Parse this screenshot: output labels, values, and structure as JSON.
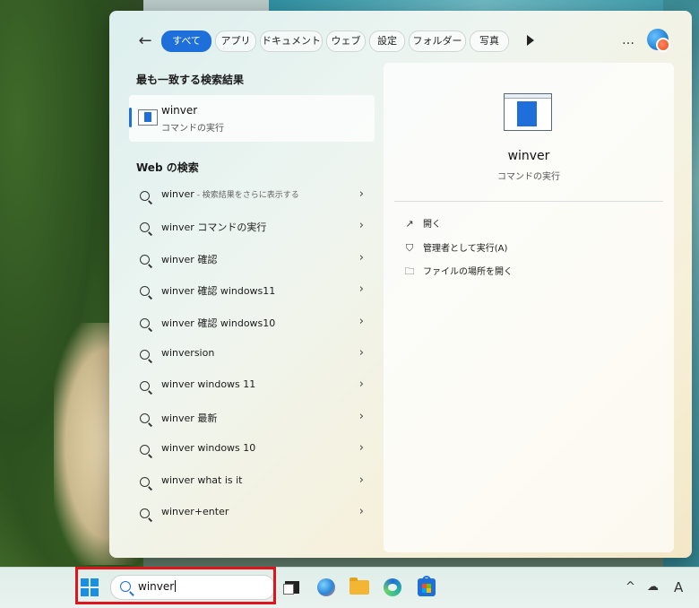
{
  "filters": {
    "back_icon": "arrow-left-icon",
    "chips": [
      {
        "label": "すべて",
        "active": true
      },
      {
        "label": "アプリ"
      },
      {
        "label": "ドキュメント"
      },
      {
        "label": "ウェブ"
      },
      {
        "label": "設定"
      },
      {
        "label": "フォルダー"
      },
      {
        "label": "写真"
      }
    ],
    "more": "…"
  },
  "best_match": {
    "section_title": "最も一致する検索結果",
    "name": "winver",
    "sub": "コマンドの実行"
  },
  "web": {
    "section_title": "Web の検索",
    "items": [
      {
        "label": "winver",
        "hint": " - 検索結果をさらに表示する"
      },
      {
        "label": "winver コマンドの実行"
      },
      {
        "label": "winver 確認"
      },
      {
        "label": "winver 確認 windows11"
      },
      {
        "label": "winver 確認 windows10"
      },
      {
        "label": "winversion"
      },
      {
        "label": "winver windows 11"
      },
      {
        "label": "winver 最新"
      },
      {
        "label": "winver windows 10"
      },
      {
        "label": "winver what is it"
      },
      {
        "label": "winver+enter"
      }
    ]
  },
  "detail": {
    "name": "winver",
    "sub": "コマンドの実行",
    "actions": [
      {
        "label": "開く",
        "icon": "open-external-icon",
        "glyph": "↗"
      },
      {
        "label": "管理者として実行(A)",
        "icon": "shield-admin-icon",
        "glyph": "⛉"
      },
      {
        "label": "ファイルの場所を開く",
        "icon": "folder-icon",
        "glyph": "🗀"
      }
    ]
  },
  "taskbar": {
    "search_value": "winver",
    "tray": {
      "chevron": "^",
      "cloud_icon": "cloud-off-icon",
      "ime": "A"
    }
  },
  "colors": {
    "accent": "#1e6fd9",
    "highlight": "#e0141b"
  }
}
